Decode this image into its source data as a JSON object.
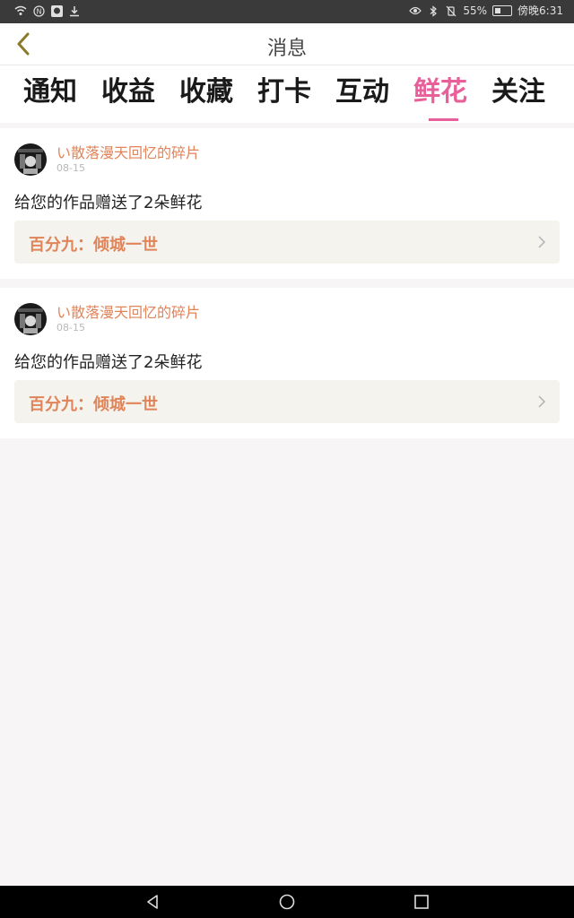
{
  "status_bar": {
    "battery_text": "55%",
    "time_text": "傍晚6:31",
    "left_icons": [
      "wifi-icon",
      "nfc-icon",
      "avatar-icon",
      "download-icon"
    ],
    "right_icons": [
      "eye-icon",
      "bluetooth-icon",
      "mute-icon",
      "battery-icon"
    ]
  },
  "nav": {
    "title": "消息",
    "back_icon": "chevron-left-icon"
  },
  "tabs": [
    {
      "label": "通知"
    },
    {
      "label": "收益"
    },
    {
      "label": "收藏"
    },
    {
      "label": "打卡"
    },
    {
      "label": "互动"
    },
    {
      "label": "鲜花"
    },
    {
      "label": "关注"
    }
  ],
  "active_tab": "鲜花",
  "messages": [
    {
      "user": "い散落漫天回忆的碎片",
      "date": "08-15",
      "text": "给您的作品赠送了2朵鲜花",
      "work_title": "百分九：倾城一世"
    },
    {
      "user": "い散落漫天回忆的碎片",
      "date": "08-15",
      "text": "给您的作品赠送了2朵鲜花",
      "work_title": "百分九：倾城一世"
    }
  ],
  "colors": {
    "accent_pink": "#e8609a",
    "name_orange": "#e0845a",
    "back_arrow": "#8a7a2a"
  }
}
